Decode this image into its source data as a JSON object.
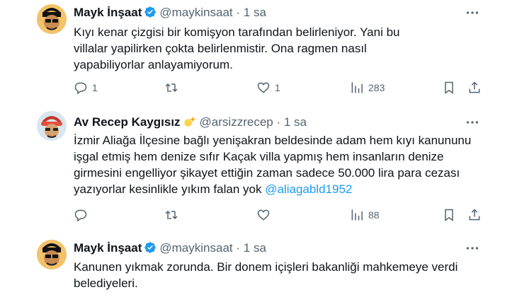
{
  "tweets": [
    {
      "name": "Mayk İnşaat",
      "handle": "@maykinsaat",
      "dot": "·",
      "time": "1 sa",
      "text": "Kıyı kenar çizgisi bir komişyon tarafından belirleniyor. Yani bu villalar yapilirken çokta  belirlenmistir. Ona ragmen nasıl yapabiliyorlar anlayamiyorum.",
      "replies": "1",
      "retweets": "",
      "likes": "1",
      "views": "283"
    },
    {
      "name": "Av Recep Kaygısız",
      "handle": "@arsizzrecep",
      "dot": "·",
      "time": "1 sa",
      "text": "İzmir Aliağa İlçesine bağlı yenişakran beldesinde adam hem kıyı kanununu işgal etmiş hem denize sıfır Kaçak villa yapmış hem insanların denize girmesini engelliyor şikayet ettiğin zaman sadece 50.000 lira para cezası yazıyorlar kesinlikle yıkım falan yok",
      "mention": "@aliagabld1952",
      "replies": "",
      "retweets": "",
      "likes": "",
      "views": "88"
    },
    {
      "name": "Mayk İnşaat",
      "handle": "@maykinsaat",
      "dot": "·",
      "time": "1 sa",
      "text": "Kanunen yıkmak zorunda. Bir donem içişleri bakanliği mahkemeye verdi belediyeleri."
    }
  ],
  "colors": {
    "accent": "#1d9bf0",
    "muted": "#536471",
    "text": "#0f1419",
    "divider": "#cfd9de"
  },
  "icons": [
    "verified-badge-icon",
    "more-icon",
    "reply-icon",
    "retweet-icon",
    "like-icon",
    "views-icon",
    "bookmark-icon",
    "share-icon",
    "sparkle-emoji-icon"
  ]
}
